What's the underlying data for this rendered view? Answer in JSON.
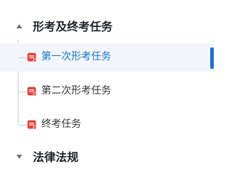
{
  "tree": {
    "sections": [
      {
        "title": "形考及终考任务",
        "expanded": true,
        "items": [
          {
            "label": "第一次形考任务",
            "active": true,
            "icon": "task-doc-icon"
          },
          {
            "label": "第二次形考任务",
            "active": false,
            "icon": "task-doc-icon"
          },
          {
            "label": "终考任务",
            "active": false,
            "icon": "task-doc-icon"
          }
        ]
      },
      {
        "title": "法律法规",
        "expanded": false
      }
    ]
  },
  "colors": {
    "active_text": "#1a73c9",
    "active_background": "#f2f6fb",
    "active_bar": "#1f6fd1",
    "icon_red": "#e8413c"
  }
}
